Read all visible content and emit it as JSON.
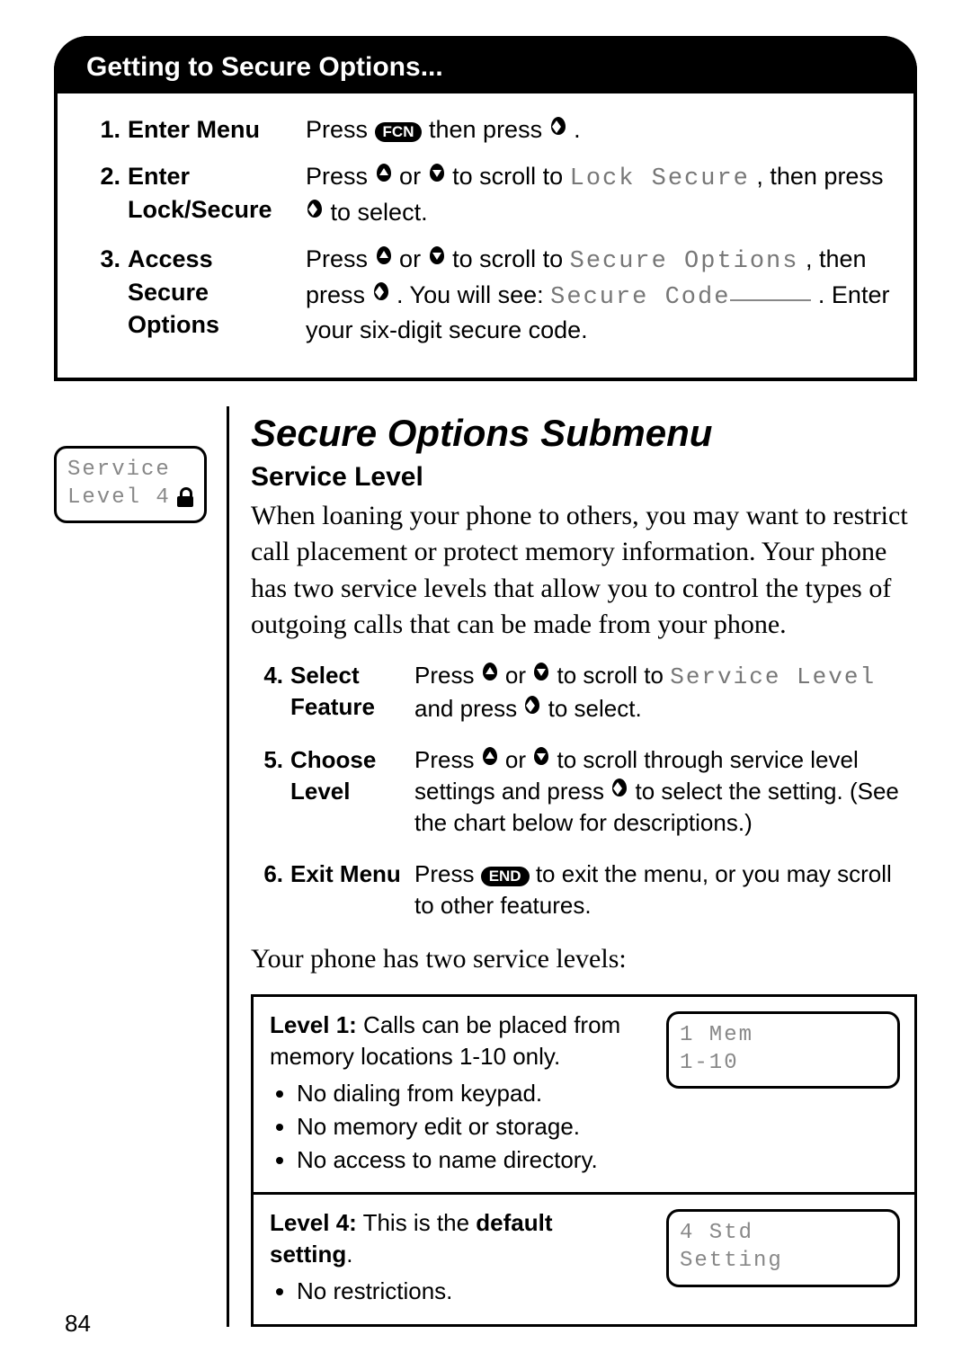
{
  "header_title": "Getting to Secure Options...",
  "steps_top": [
    {
      "num": "1.",
      "label": "Enter Menu",
      "desc_pre": "Press ",
      "pill1": "FCN",
      "desc_mid": " then press ",
      "icon1": "sel",
      "desc_post": "."
    },
    {
      "num": "2.",
      "label": "Enter Lock/Secure",
      "desc_pre": "Press ",
      "icon1": "up",
      "or": " or ",
      "icon2": "down",
      "mid1": " to scroll to ",
      "lcd1": "Lock Secure",
      "mid2": ", then press ",
      "icon3": "sel",
      "post": " to select."
    },
    {
      "num": "3.",
      "label": "Access Secure Options",
      "desc_pre": "Press ",
      "icon1": "up",
      "or": " or ",
      "icon2": "down",
      "mid1": " to scroll to ",
      "lcd1": "Secure Options",
      "mid2": ", then press ",
      "icon3": "sel",
      "post1": ". You will see: ",
      "lcd2": "Secure Code",
      "post2": ". Enter your six-digit secure code."
    }
  ],
  "lcd_left": {
    "line1": "Service",
    "line2a": "Level 4"
  },
  "title": "Secure Options Submenu",
  "subhead": "Service Level",
  "paragraph": "When loaning your phone to others, you may want to restrict call placement or protect memory information. Your phone has two service levels that allow you to control the types of outgoing calls that can be made from your phone.",
  "steps_inner": [
    {
      "num": "4.",
      "label": "Select Feature",
      "pre": "Press ",
      "icon1": "up",
      "or": " or ",
      "icon2": "down",
      "mid1": " to scroll to ",
      "lcd1": "Service Level",
      "mid2": " and press ",
      "icon3": "sel",
      "post": " to select."
    },
    {
      "num": "5.",
      "label": "Choose Level",
      "pre": "Press ",
      "icon1": "up",
      "or": " or ",
      "icon2": "down",
      "mid1": " to scroll through service level settings and press ",
      "icon3": "sel",
      "post": " to select the setting. (See the chart below for descriptions.)"
    },
    {
      "num": "6.",
      "label": "Exit Menu",
      "pre": "Press ",
      "pill1": "END",
      "post": " to exit the menu, or you may scroll to other features."
    }
  ],
  "paragraph2": "Your phone has two service levels:",
  "levels": [
    {
      "title": "Level 1:",
      "lead": " Calls can be placed from memory locations 1-10 only.",
      "bullets": [
        "No dialing from keypad.",
        "No memory edit or storage.",
        "No access to name directory."
      ],
      "screen": {
        "l1": "1 Mem",
        "l2": "1-10"
      }
    },
    {
      "title": "Level 4:",
      "lead_pre": " This is the ",
      "lead_bold": "default setting",
      "lead_post": ".",
      "bullets": [
        "No restrictions."
      ],
      "screen": {
        "l1": "4 Std",
        "l2": "Setting"
      }
    }
  ],
  "page_number": "84"
}
